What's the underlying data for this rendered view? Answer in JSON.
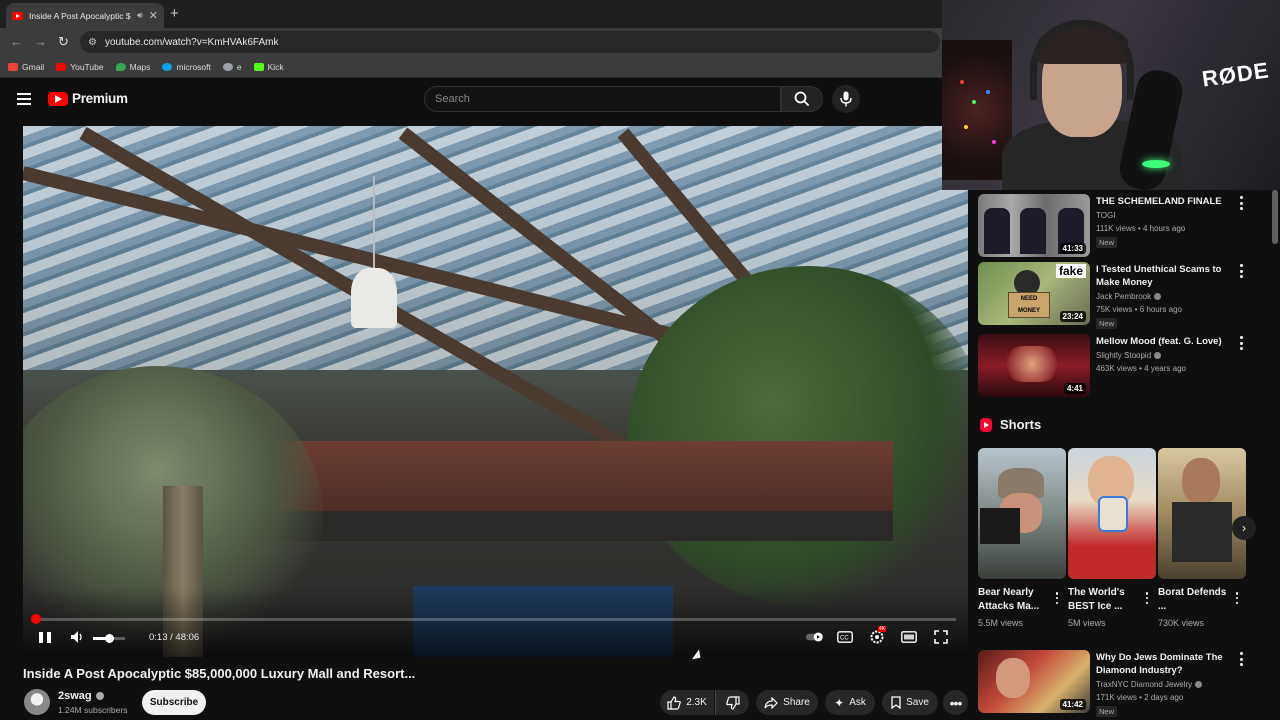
{
  "browser": {
    "tab_title": "Inside A Post Apocalyptic $",
    "new_tab": "+",
    "close": "✕",
    "url": "youtube.com/watch?v=KmHVAk6FAmk",
    "bookmarks": [
      {
        "label": "Gmail",
        "icon": "gmail-icon",
        "color": "#ea4335"
      },
      {
        "label": "YouTube",
        "icon": "youtube-icon",
        "color": "#ff0000"
      },
      {
        "label": "Maps",
        "icon": "maps-icon",
        "color": "#34a853"
      },
      {
        "label": "microsoft",
        "icon": "microsoft-icon",
        "color": "#00a4ef"
      },
      {
        "label": "e",
        "icon": "globe-icon",
        "color": "#9aa0a6"
      },
      {
        "label": "Kick",
        "icon": "kick-icon",
        "color": "#53fc18"
      }
    ]
  },
  "header": {
    "logo_text": "Premium",
    "search_placeholder": "Search"
  },
  "player": {
    "current_time": "0:13",
    "duration": "48:06",
    "time_display": "0:13 / 48:06",
    "progress": 0.0045,
    "volume": 0.5,
    "settings_badge": "4K"
  },
  "video": {
    "title": "Inside A Post Apocalyptic $85,000,000 Luxury Mall and Resort...",
    "channel": "2swag",
    "subscribers": "1.24M subscribers",
    "subscribe_label": "Subscribe",
    "likes": "2.3K",
    "share_label": "Share",
    "ask_label": "Ask",
    "save_label": "Save"
  },
  "webcam": {
    "brand": "RØDE"
  },
  "sidebar": {
    "items": [
      {
        "title": "THE SCHEMELAND FINALE",
        "channel": "TOGI",
        "meta": "111K views • 4 hours ago",
        "badge": "New",
        "duration": "41:33",
        "verified": false
      },
      {
        "title": "I Tested Unethical Scams to Make Money",
        "channel": "Jack Pembrook",
        "meta": "75K views • 6 hours ago",
        "badge": "New",
        "duration": "23:24",
        "verified": true,
        "thumb_text": "fake",
        "sign_text": "NEED MONEY"
      },
      {
        "title": "Mellow Mood (feat. G. Love)",
        "channel": "Slightly Stoopid",
        "meta": "463K views • 4 years ago",
        "badge": "",
        "duration": "4:41",
        "verified": true
      },
      {
        "title": "Why Do Jews Dominate The Diamond Industry?",
        "channel": "TraxNYC Diamond Jewelry",
        "meta": "171K views • 2 days ago",
        "badge": "New",
        "duration": "41:42",
        "verified": true
      }
    ],
    "shorts_label": "Shorts",
    "shorts": [
      {
        "title": "Bear Nearly Attacks Ma...",
        "views": "5.5M views"
      },
      {
        "title": "The World's BEST Ice ...",
        "views": "5M views"
      },
      {
        "title": "Borat Defends ...",
        "views": "730K views"
      }
    ]
  },
  "colors": {
    "accent": "#ff0000",
    "background": "#0f0f0f",
    "chip": "#272727"
  }
}
